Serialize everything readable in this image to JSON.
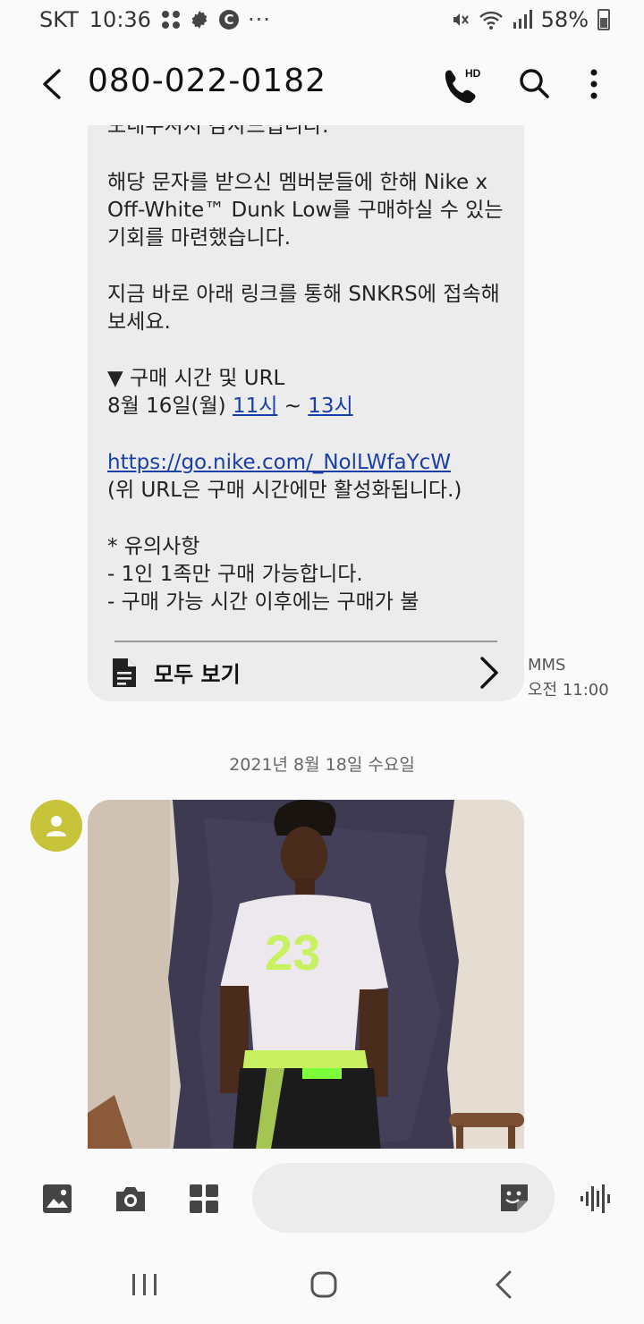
{
  "status_bar": {
    "carrier": "SKT",
    "time": "10:36",
    "overflow": "···",
    "battery": "58%",
    "icons": [
      "apps-grid-icon",
      "settings-gear-icon",
      "c-badge-icon",
      "mute-icon",
      "wifi-icon",
      "signal-icon",
      "battery-icon"
    ]
  },
  "header": {
    "title": "080-022-0182",
    "back_icon": "back-arrow-icon",
    "call_icon": "hd-call-icon",
    "call_badge": "HD",
    "search_icon": "search-icon",
    "more_icon": "more-vert-icon"
  },
  "message": {
    "line_top": "모내주셔서 감사드립니다.",
    "para1": "해당 문자를 받으신 멤버분들에 한해 Nike x Off-White™ Dunk Low를 구매하실 수 있는 기회를 마련했습니다.",
    "para2": "지금 바로 아래 링크를 통해 SNKRS에 접속해보세요.",
    "schedule_heading": "▼ 구매 시간 및 URL",
    "schedule_date": "8월 16일(월) ",
    "time_start": "11시",
    "time_sep": " ~ ",
    "time_end": "13시",
    "url": "https://go.nike.com/_NolLWfaYcW",
    "url_note": "(위 URL은 구매 시간에만 활성화됩니다.)",
    "notice_heading": "* 유의사항",
    "notice_1": "- 1인 1족만 구매 가능합니다.",
    "notice_2": "- 구매 가능 시간 이후에는 구매가 불",
    "view_all": "모두 보기",
    "type": "MMS",
    "time": "오전 11:00"
  },
  "date_separator": "2021년 8월 18일 수요일",
  "photo": {
    "shirt_number": "23",
    "colors": {
      "wall": "#d9cfc4",
      "paint": "#3e3a52",
      "shirt": "#ece8ee",
      "accent": "#c8f060"
    }
  },
  "input_bar": {
    "icons": [
      "gallery-icon",
      "camera-icon",
      "apps-icon",
      "sticker-icon",
      "voice-icon"
    ]
  },
  "nav_bar": {
    "icons": [
      "recents-icon",
      "home-icon",
      "back-icon"
    ]
  },
  "colors": {
    "bubble": "#ececec",
    "link": "#1a3fa8",
    "avatar": "#c7c33a",
    "background": "#fafafa"
  }
}
